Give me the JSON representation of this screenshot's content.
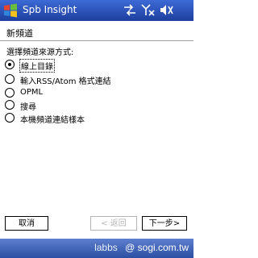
{
  "titlebar": {
    "app_title": "Spb Insight",
    "icons": [
      "windows-start-icon",
      "sync-icon",
      "signal-off-icon",
      "volume-icon"
    ],
    "color": "#2450b8"
  },
  "page": {
    "subtitle": "新頻道",
    "prompt": "選擇頻道來源方式:"
  },
  "options": [
    {
      "label": "線上目錄",
      "selected": true
    },
    {
      "label": "輸入RSS/Atom 格式連結",
      "selected": false
    },
    {
      "label": "OPML",
      "selected": false
    },
    {
      "label": "搜尋",
      "selected": false
    },
    {
      "label": "本機頻道連結樣本",
      "selected": false
    }
  ],
  "buttons": {
    "cancel": "取消",
    "back": "< 返回",
    "next": "下一步>"
  },
  "watermark": {
    "labbs": "labbs",
    "site": "@ sogi.com.tw"
  }
}
